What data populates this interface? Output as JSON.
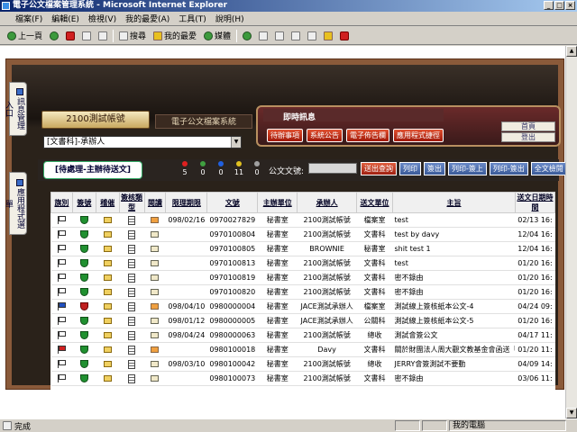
{
  "window": {
    "title": "電子公文檔案管理系統 - Microsoft Internet Explorer"
  },
  "menu": [
    "檔案(F)",
    "編輯(E)",
    "檢視(V)",
    "我的最愛(A)",
    "工具(T)",
    "說明(H)"
  ],
  "toolbar": {
    "back": "上一頁",
    "search": "搜尋",
    "favorites": "我的最愛",
    "media": "媒體"
  },
  "app": {
    "account": "2100測試帳號",
    "system_name": "電子公文檔案系統",
    "unit_select": "[文書科]-承辦人",
    "side_tabs": [
      "訊息管理入口",
      "應用程式選單"
    ],
    "news_title": "即時訊息",
    "news_links": [
      "待辦事項",
      "系統公告",
      "電子佈告欄",
      "應用程式捷徑"
    ],
    "home_links": [
      "首頁",
      "登出"
    ],
    "pending_tab": "[待處理-主辦待送文]",
    "counters": [
      {
        "color": "#e02020",
        "value": "5"
      },
      {
        "color": "#40a040",
        "value": "0"
      },
      {
        "color": "#2060e0",
        "value": "0"
      },
      {
        "color": "#e0c020",
        "value": "11"
      },
      {
        "color": "#a0a0a0",
        "value": "0"
      }
    ],
    "doc_label": "公文文號:",
    "actions": [
      "送出查詢",
      "列印",
      "簽出",
      "列印-簽上",
      "列印-簽出",
      "全文檢閱"
    ]
  },
  "table": {
    "headers": [
      "旗別",
      "簽號",
      "稽催",
      "簽核類型",
      "閱讀",
      "限理期限",
      "文號",
      "主辦單位",
      "承辦人",
      "送文單位",
      "主旨",
      "送文日期時間"
    ],
    "rows": [
      {
        "flag": "",
        "shield": "g",
        "deadline": "098/02/16",
        "docno": "0970027829",
        "unit": "秘書室",
        "handler": "2100測試帳號",
        "from": "檔案室",
        "subject": "test",
        "time": "02/13 16:"
      },
      {
        "flag": "",
        "shield": "g",
        "deadline": "",
        "docno": "0970100804",
        "unit": "秘書室",
        "handler": "2100測試帳號",
        "from": "文書科",
        "subject": "test by davy",
        "time": "12/04 16:"
      },
      {
        "flag": "",
        "shield": "g",
        "deadline": "",
        "docno": "0970100805",
        "unit": "秘書室",
        "handler": "BROWNIE",
        "from": "秘書室",
        "subject": "shit test 1",
        "time": "12/04 16:"
      },
      {
        "flag": "",
        "shield": "g",
        "deadline": "",
        "docno": "0970100813",
        "unit": "秘書室",
        "handler": "2100測試帳號",
        "from": "文書科",
        "subject": "test",
        "time": "01/20 16:"
      },
      {
        "flag": "",
        "shield": "g",
        "deadline": "",
        "docno": "0970100819",
        "unit": "秘書室",
        "handler": "2100測試帳號",
        "from": "文書科",
        "subject": "密不錄由",
        "time": "01/20 16:"
      },
      {
        "flag": "",
        "shield": "g",
        "deadline": "",
        "docno": "0970100820",
        "unit": "秘書室",
        "handler": "2100測試帳號",
        "from": "文書科",
        "subject": "密不錄由",
        "time": "01/20 16:"
      },
      {
        "flag": "blue",
        "shield": "r",
        "deadline": "098/04/10",
        "docno": "0980000004",
        "unit": "秘書室",
        "handler": "JACE測試承辦人",
        "from": "檔案室",
        "subject": "測試線上簽核紙本公文-4",
        "time": "04/24 09:"
      },
      {
        "flag": "",
        "shield": "g",
        "deadline": "098/01/12",
        "docno": "0980000005",
        "unit": "秘書室",
        "handler": "JACE測試承辦人",
        "from": "公關科",
        "subject": "測試線上簽核紙本公文-5",
        "time": "01/20 16:"
      },
      {
        "flag": "",
        "shield": "g",
        "deadline": "098/04/24",
        "docno": "0980000063",
        "unit": "秘書室",
        "handler": "2100測試帳號",
        "from": "總收",
        "subject": "測試會簽公文",
        "time": "04/17 11:"
      },
      {
        "flag": "red",
        "shield": "g",
        "deadline": "",
        "docno": "0980100018",
        "unit": "秘書室",
        "handler": "Davy",
        "from": "文書科",
        "subject": "關於財團法人周大觀文教基金會函送「全球熱愛生命獎章授獎辦法」...",
        "time": "01/20 11:"
      },
      {
        "flag": "",
        "shield": "g",
        "deadline": "098/03/10",
        "docno": "0980100042",
        "unit": "秘書室",
        "handler": "2100測試帳號",
        "from": "總收",
        "subject": "JERRY會簽測試不要動",
        "time": "04/09 14:"
      },
      {
        "flag": "",
        "shield": "g",
        "deadline": "",
        "docno": "0980100073",
        "unit": "秘書室",
        "handler": "2100測試帳號",
        "from": "文書科",
        "subject": "密不錄由",
        "time": "03/06 11:"
      }
    ]
  },
  "status": {
    "text": "完成",
    "zone": "我的電腦"
  }
}
